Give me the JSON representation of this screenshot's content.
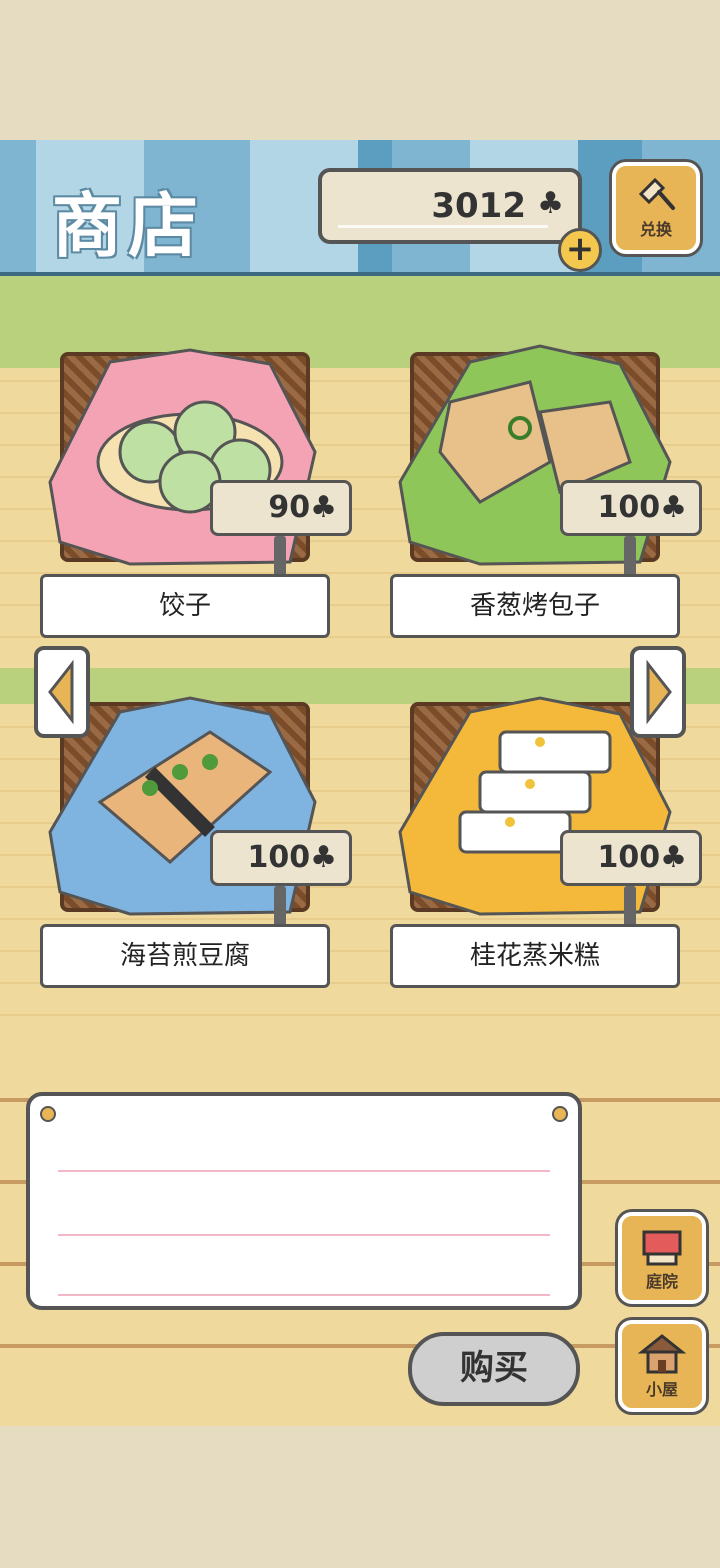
{
  "header": {
    "title": "商店",
    "currency_value": "3012",
    "currency_symbol": "♣",
    "plus_label": "+",
    "exchange_label": "兑换"
  },
  "items": [
    {
      "name": "饺子",
      "price": "90",
      "cloth_color": "#f4a3b4"
    },
    {
      "name": "香葱烤包子",
      "price": "100",
      "cloth_color": "#8fc65a"
    },
    {
      "name": "海苔煎豆腐",
      "price": "100",
      "cloth_color": "#7fb4e0"
    },
    {
      "name": "桂花蒸米糕",
      "price": "100",
      "cloth_color": "#f4b93a"
    }
  ],
  "buttons": {
    "buy_label": "购买",
    "yard_label": "庭院",
    "house_label": "小屋"
  },
  "colors": {
    "header_blue": "#5b9ec0",
    "shelf_green": "#b9d17d",
    "wood": "#f0d99c",
    "accent": "#e7b556"
  }
}
